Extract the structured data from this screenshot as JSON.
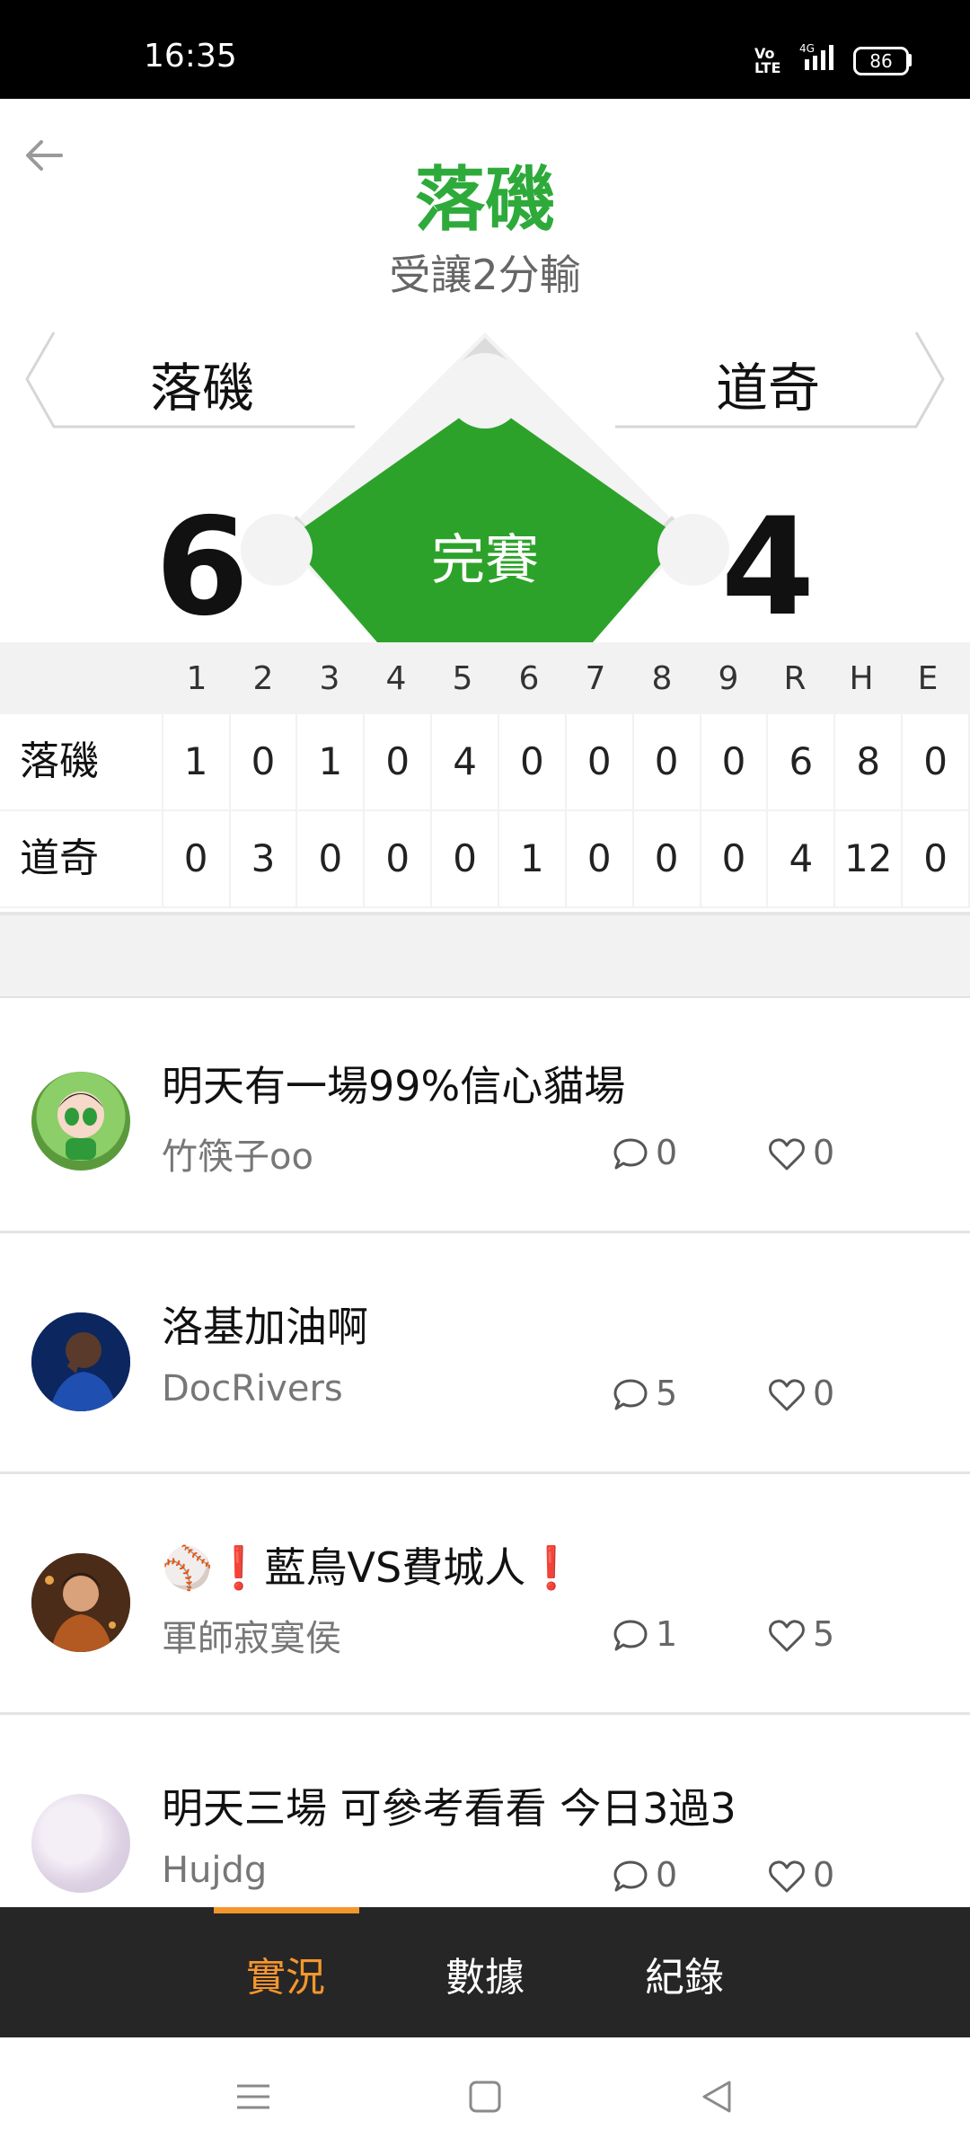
{
  "status_bar": {
    "time": "16:35",
    "network": "4G",
    "battery": "86"
  },
  "header": {
    "title": "落磯",
    "subtitle": "受讓2分輸"
  },
  "scoreboard": {
    "home_team": "落磯",
    "away_team": "道奇",
    "home_score": "6",
    "away_score": "4",
    "status": "完賽"
  },
  "linescore": {
    "headers": [
      "1",
      "2",
      "3",
      "4",
      "5",
      "6",
      "7",
      "8",
      "9",
      "R",
      "H",
      "E"
    ],
    "rows": [
      {
        "team": "落磯",
        "cells": [
          "1",
          "0",
          "1",
          "0",
          "4",
          "0",
          "0",
          "0",
          "0",
          "6",
          "8",
          "0"
        ]
      },
      {
        "team": "道奇",
        "cells": [
          "0",
          "3",
          "0",
          "0",
          "0",
          "1",
          "0",
          "0",
          "0",
          "4",
          "12",
          "0"
        ]
      }
    ]
  },
  "posts": [
    {
      "title": "明天有一場99%信心貓場",
      "author": "竹筷子oo",
      "comments": "0",
      "likes": "0"
    },
    {
      "title": "洛基加油啊",
      "author": "DocRivers",
      "comments": "5",
      "likes": "0"
    },
    {
      "title": "⚾❗藍鳥VS費城人❗",
      "author": "軍師寂寞侯",
      "comments": "1",
      "likes": "5"
    },
    {
      "title": "明天三場 可參考看看 今日3過3",
      "author": "Hujdg",
      "comments": "0",
      "likes": "0"
    }
  ],
  "tabs": {
    "live": "實況",
    "stats": "數據",
    "records": "紀錄",
    "active": "live"
  },
  "colors": {
    "accent_green": "#2eaa3b",
    "tab_active": "#f5962d",
    "tab_bar": "#262626"
  },
  "icons": [
    "back-arrow-icon",
    "comment-icon",
    "heart-icon",
    "menu-icon",
    "home-icon",
    "back-triangle-icon"
  ]
}
